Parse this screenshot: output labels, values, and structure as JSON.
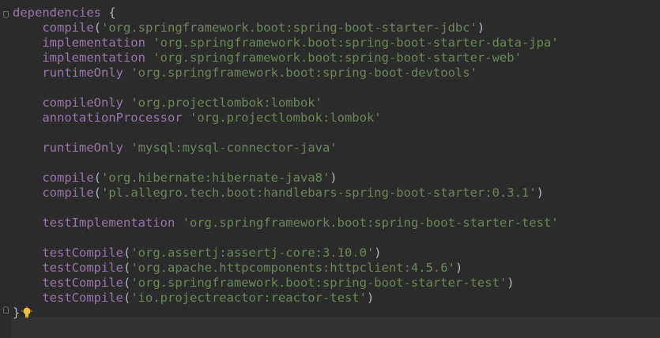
{
  "editor": {
    "lines": [
      {
        "type": "open",
        "kw": "dependencies",
        "rest": " {"
      },
      {
        "type": "call",
        "kw": "compile",
        "open": "(",
        "str": "'org.springframework.boot:spring-boot-starter-jdbc'",
        "close": ")"
      },
      {
        "type": "space",
        "kw": "implementation",
        "sep": " ",
        "str": "'org.springframework.boot:spring-boot-starter-data-jpa'"
      },
      {
        "type": "space",
        "kw": "implementation",
        "sep": " ",
        "str": "'org.springframework.boot:spring-boot-starter-web'"
      },
      {
        "type": "space",
        "kw": "runtimeOnly",
        "sep": " ",
        "str": "'org.springframework.boot:spring-boot-devtools'"
      },
      {
        "type": "blank"
      },
      {
        "type": "space",
        "kw": "compileOnly",
        "sep": " ",
        "str": "'org.projectlombok:lombok'"
      },
      {
        "type": "space",
        "kw": "annotationProcessor",
        "sep": " ",
        "str": "'org.projectlombok:lombok'"
      },
      {
        "type": "blank"
      },
      {
        "type": "space",
        "kw": "runtimeOnly",
        "sep": " ",
        "str": "'mysql:mysql-connector-java'"
      },
      {
        "type": "blank"
      },
      {
        "type": "call",
        "kw": "compile",
        "open": "(",
        "str": "'org.hibernate:hibernate-java8'",
        "close": ")"
      },
      {
        "type": "call",
        "kw": "compile",
        "open": "(",
        "str": "'pl.allegro.tech.boot:handlebars-spring-boot-starter:0.3.1'",
        "close": ")"
      },
      {
        "type": "blank"
      },
      {
        "type": "space",
        "kw": "testImplementation",
        "sep": " ",
        "str": "'org.springframework.boot:spring-boot-starter-test'"
      },
      {
        "type": "blank"
      },
      {
        "type": "call",
        "kw": "testCompile",
        "open": "(",
        "str": "'org.assertj:assertj-core:3.10.0'",
        "close": ")"
      },
      {
        "type": "call",
        "kw": "testCompile",
        "open": "(",
        "str": "'org.apache.httpcomponents:httpclient:4.5.6'",
        "close": ")"
      },
      {
        "type": "call",
        "kw": "testCompile",
        "open": "(",
        "str": "'org.springframework.boot:spring-boot-starter-test'",
        "close": ")"
      },
      {
        "type": "call",
        "kw": "testCompile",
        "open": "(",
        "str": "'io.projectreactor:reactor-test'",
        "close": ")"
      },
      {
        "type": "close",
        "rest": "}"
      }
    ],
    "indent": "    ",
    "icons": {
      "intention": "lightbulb-icon",
      "fold": "fold-marker-icon"
    },
    "colors": {
      "background": "#2b2b2b",
      "keyword": "#9876aa",
      "string": "#6a8759",
      "plain": "#a9b7c6",
      "current_line": "#323232",
      "bulb": "#f2c23a"
    }
  }
}
